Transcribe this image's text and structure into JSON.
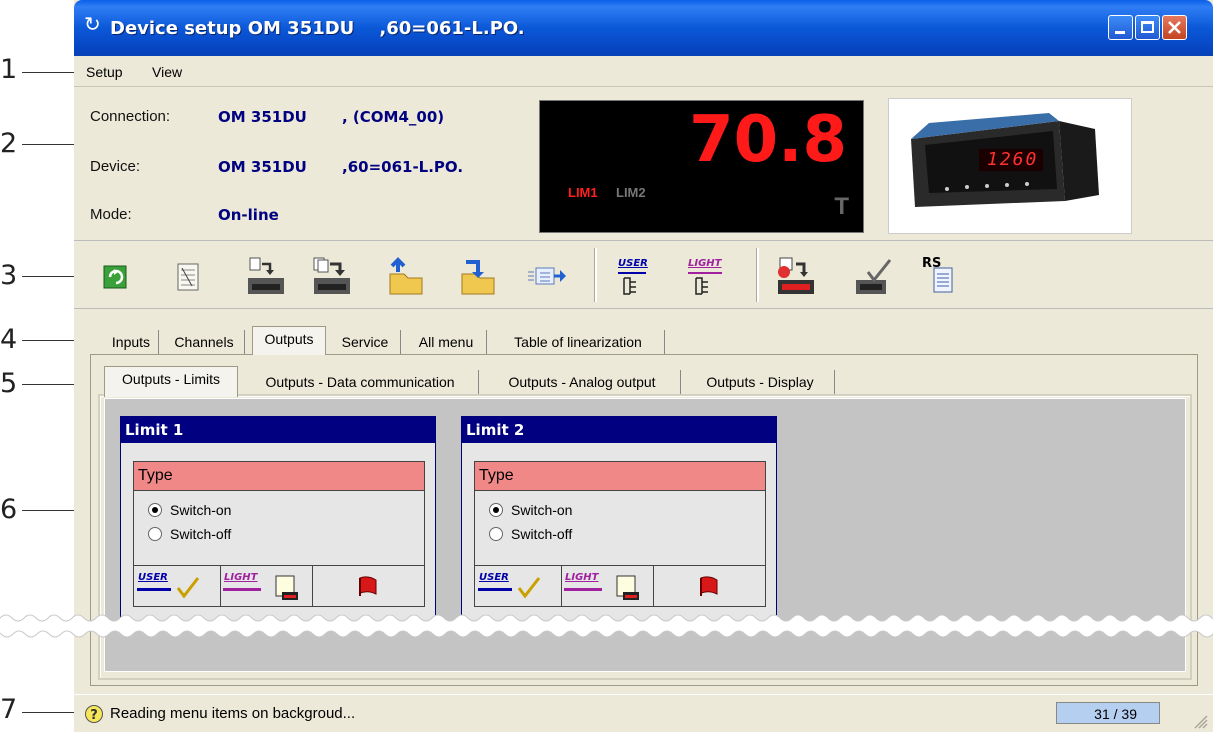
{
  "callouts": [
    "1",
    "2",
    "3",
    "4",
    "5",
    "6",
    "7"
  ],
  "window": {
    "title_prefix": "Device setup OM 351DU",
    "title_suffix": ",60=061-L.PO."
  },
  "menu": [
    "Setup",
    "View"
  ],
  "info": {
    "connection_label": "Connection:",
    "connection_value": "OM 351DU",
    "connection_port": ", (COM4_00)",
    "device_label": "Device:",
    "device_value": "OM 351DU",
    "device_code": ",60=061-L.PO.",
    "mode_label": "Mode:",
    "mode_value": "On-line"
  },
  "display": {
    "value": "70.8",
    "lim1": "LIM1",
    "lim2": "LIM2",
    "t": "T",
    "photo_readout": "1260"
  },
  "toolbar_icons": [
    "refresh-icon",
    "spreadsheet-icon",
    "download-to-device-icon",
    "download-all-to-device-icon",
    "open-folder-icon",
    "save-folder-icon",
    "transfer-icon",
    "user-menu-icon",
    "light-menu-icon",
    "download-clock-icon",
    "device-check-icon",
    "rs-document-icon"
  ],
  "toolbar_labels": {
    "user": "USER",
    "light": "LIGHT",
    "rs": "RS"
  },
  "tabs": [
    "Inputs",
    "Channels",
    "Outputs",
    "Service",
    "All menu",
    "Table of linearization"
  ],
  "subtabs": [
    "Outputs - Limits",
    "Outputs - Data communication",
    "Outputs - Analog output",
    "Outputs - Display"
  ],
  "limits": [
    {
      "title": "Limit 1",
      "type_label": "Type",
      "options": [
        "Switch-on",
        "Switch-off"
      ],
      "selected": 0,
      "user": "USER",
      "light": "LIGHT"
    },
    {
      "title": "Limit 2",
      "type_label": "Type",
      "options": [
        "Switch-on",
        "Switch-off"
      ],
      "selected": 0,
      "user": "USER",
      "light": "LIGHT"
    }
  ],
  "status": {
    "text": "Reading menu items on backgroud...",
    "counter": "31 / 39"
  },
  "colors": {
    "title_bar": "#0b58d8",
    "value_text": "#000080",
    "led_red": "#ff1a1a",
    "type_header": "#f18888",
    "limit_header": "#000080",
    "user_blue": "#0000aa",
    "light_purple": "#a020a0"
  }
}
